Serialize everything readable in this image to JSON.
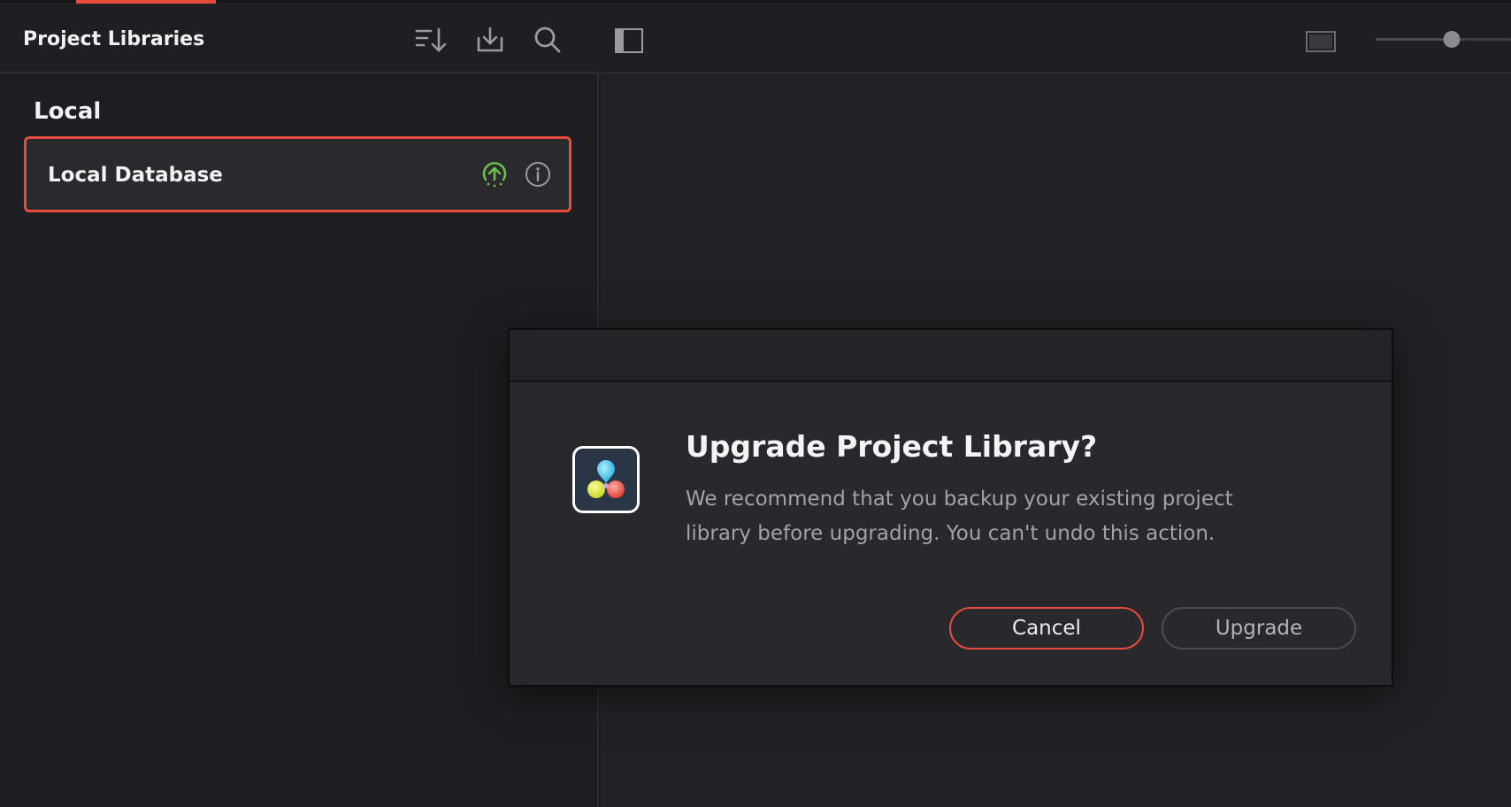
{
  "left_panel": {
    "title": "Project Libraries",
    "section_label": "Local",
    "items": [
      {
        "label": "Local Database",
        "status_icon": "cloud-upload-icon",
        "info_icon": "info-icon"
      }
    ],
    "header_icons": [
      "sort-icon",
      "import-icon",
      "search-icon"
    ]
  },
  "right_panel": {
    "header_icons": [
      "sidebar-toggle-icon",
      "view-mode-icon"
    ],
    "zoom_slider": {
      "value": 0.56
    }
  },
  "dialog": {
    "title": "Upgrade Project Library?",
    "message": "We recommend that you backup your existing project library before upgrading. You can't undo this action.",
    "cancel_label": "Cancel",
    "upgrade_label": "Upgrade",
    "app_icon": "davinci-resolve-logo-icon"
  },
  "colors": {
    "accent": "#e64b3c",
    "status_green": "#6cc04a",
    "background": "#1e1e22"
  }
}
